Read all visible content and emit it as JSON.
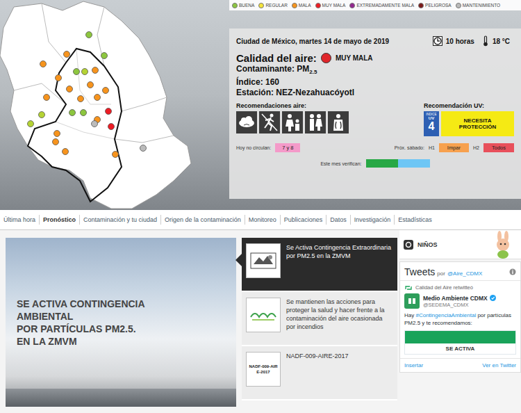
{
  "legend": [
    {
      "label": "BUENA",
      "color": "#8dc63f"
    },
    {
      "label": "REGULAR",
      "color": "#f5e43a"
    },
    {
      "label": "MALA",
      "color": "#f7941d"
    },
    {
      "label": "MUY MALA",
      "color": "#ed1c24"
    },
    {
      "label": "EXTREMADAMENTE MALA",
      "color": "#93278f"
    },
    {
      "label": "PELIGROSA",
      "color": "#7b1a1a"
    },
    {
      "label": "MANTENIMIENTO",
      "color": "#bbbbbb"
    }
  ],
  "stations": [
    {
      "color": "#8dc63f"
    },
    {
      "color": "#f7941d"
    },
    {
      "color": "#8dc63f"
    },
    {
      "color": "#f7941d"
    },
    {
      "color": "#8dc63f"
    },
    {
      "color": "#b5d334"
    },
    {
      "color": "#f7941d"
    },
    {
      "color": "#f7941d"
    },
    {
      "color": "#f7941d"
    },
    {
      "color": "#f7941d"
    },
    {
      "color": "#f7941d"
    },
    {
      "color": "#f7941d"
    },
    {
      "color": "#f7941d"
    },
    {
      "color": "#f7941d"
    },
    {
      "color": "#b5d334"
    },
    {
      "color": "#8dc63f"
    },
    {
      "color": "#8dc63f"
    },
    {
      "color": "#f7941d"
    },
    {
      "color": "#ed1c24"
    },
    {
      "color": "#b5d334"
    },
    {
      "color": "#f7941d"
    },
    {
      "color": "#bbbbbb"
    },
    {
      "color": "#ed1c24"
    },
    {
      "color": "#f7941d"
    },
    {
      "color": "#f7941d"
    },
    {
      "color": "#bbbbbb"
    },
    {
      "color": "#f7941d"
    }
  ],
  "info": {
    "date": "Ciudad de México, martes 14 de mayo de 2019",
    "hour": "10 horas",
    "temp": "18 °C",
    "quality_label": "Calidad del aire:",
    "quality": "MUY MALA",
    "quality_color": "#e0262b",
    "contaminant_label": "Contaminante:",
    "contaminant": "PM",
    "contaminant_sub": "2.5",
    "index_label": "Índice:",
    "index": "160",
    "station_label": "Estación:",
    "station": "NEZ-Nezahuacóyotl",
    "rec_air_label": "Recomendaciones aire:",
    "rec_uv_label": "Recomendación UV:",
    "uv_top": "INDICE",
    "uv_mid": "UV",
    "uv_value": "4",
    "uv_text": "NECESITA PROTECCIÓN",
    "no_circulan_label": "Hoy no circulan:",
    "no_circulan": "7 y 8",
    "sabado_label": "Próx. sábado:",
    "h1": "H1",
    "h1_value": "Impar",
    "h2": "H2",
    "h2_value": "Todos",
    "verifican_label": "Este mes verifican:",
    "verifican_colors": [
      "#27a845",
      "#6ec6f5"
    ]
  },
  "nav": [
    {
      "label": "Última hora",
      "selected": false
    },
    {
      "label": "Pronóstico",
      "selected": true
    },
    {
      "label": "Contaminación y tu ciudad",
      "selected": false
    },
    {
      "label": "Origen de la contaminación",
      "selected": false
    },
    {
      "label": "Monitoreo",
      "selected": false
    },
    {
      "label": "Publicaciones",
      "selected": false
    },
    {
      "label": "Datos",
      "selected": false
    },
    {
      "label": "Investigación",
      "selected": false
    },
    {
      "label": "Estadísticas",
      "selected": false
    }
  ],
  "banner": {
    "lines": [
      "SE ACTIVA CONTINGENCIA",
      "AMBIENTAL",
      "POR PARTÍCULAS PM2.5.",
      "EN LA ZMVM"
    ]
  },
  "news": [
    {
      "title": "Se Activa Contingencia Extraordinaria por PM2.5 en la ZMVM",
      "selected": true,
      "kind": "logo"
    },
    {
      "title": "Se mantienen las acciones para proteger la salud y hacer frente a la contaminación del aire ocasionada por incendios",
      "selected": false,
      "kind": "came"
    },
    {
      "title": "NADF-009-AIRE-2017",
      "selected": false,
      "kind": "doc",
      "thumb_text": "NADF-009-AIRE-2017"
    }
  ],
  "kids": {
    "label": "NIÑOS"
  },
  "tweets": {
    "title": "Tweets",
    "by": "por",
    "handle": "@Aire_CDMX",
    "retweet": "Calidad del Aire retwitteó",
    "author": "Medio Ambiente CDMX",
    "author_handle": "@SEDEMA_CDMX",
    "text_before": "Hay ",
    "hashtag": "#ContingenciaAmbiental",
    "text_after": " por partículas PM2.5 y te recomendamos:",
    "card_text": "SE ACTIVA",
    "footer": [
      "Insertar",
      "Ver en Twitter"
    ]
  }
}
